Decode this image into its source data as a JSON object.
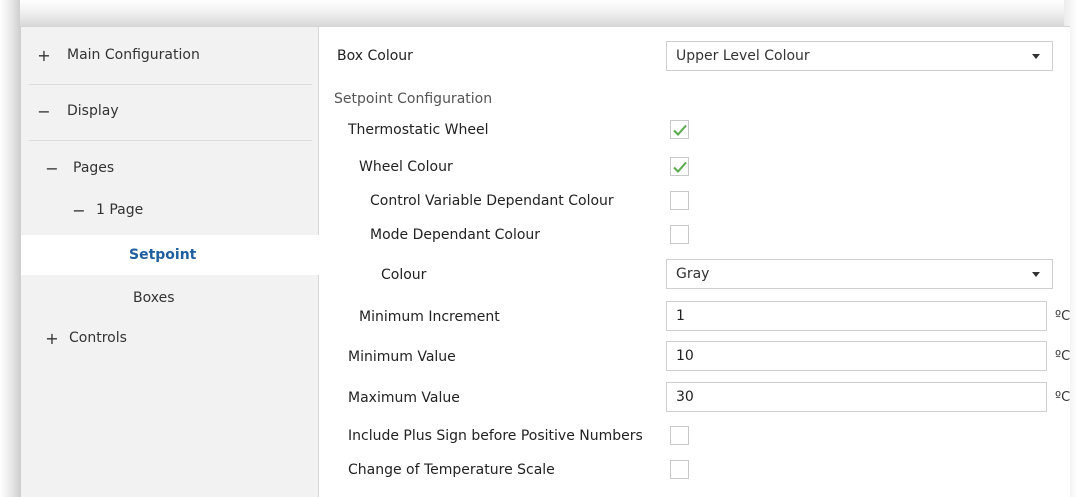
{
  "sidebar": {
    "items": [
      {
        "symbol": "+",
        "label": "Main Configuration"
      },
      {
        "symbol": "−",
        "label": "Display"
      },
      {
        "symbol": "−",
        "label": "Pages"
      },
      {
        "symbol": "−",
        "label": "1 Page"
      },
      {
        "symbol": "",
        "label": "Setpoint"
      },
      {
        "symbol": "",
        "label": "Boxes"
      },
      {
        "symbol": "+",
        "label": "Controls"
      }
    ]
  },
  "main": {
    "box_colour": {
      "label": "Box Colour",
      "value": "Upper Level Colour"
    },
    "setpoint_section": "Setpoint Configuration",
    "thermostatic_wheel": {
      "label": "Thermostatic Wheel",
      "checked": true
    },
    "wheel_colour": {
      "label": "Wheel Colour",
      "checked": true
    },
    "control_variable_colour": {
      "label": "Control Variable Dependant Colour",
      "checked": false
    },
    "mode_colour": {
      "label": "Mode Dependant Colour",
      "checked": false
    },
    "colour": {
      "label": "Colour",
      "value": "Gray"
    },
    "min_increment": {
      "label": "Minimum Increment",
      "value": "1",
      "unit": "ºC"
    },
    "min_value": {
      "label": "Minimum Value",
      "value": "10",
      "unit": "ºC"
    },
    "max_value": {
      "label": "Maximum Value",
      "value": "30",
      "unit": "ºC"
    },
    "plus_sign": {
      "label": "Include Plus Sign before Positive Numbers",
      "checked": false
    },
    "temp_scale": {
      "label": "Change of Temperature Scale",
      "checked": false
    }
  },
  "colors": {
    "accent": "#1f5f9e",
    "check": "#5aa84c"
  }
}
